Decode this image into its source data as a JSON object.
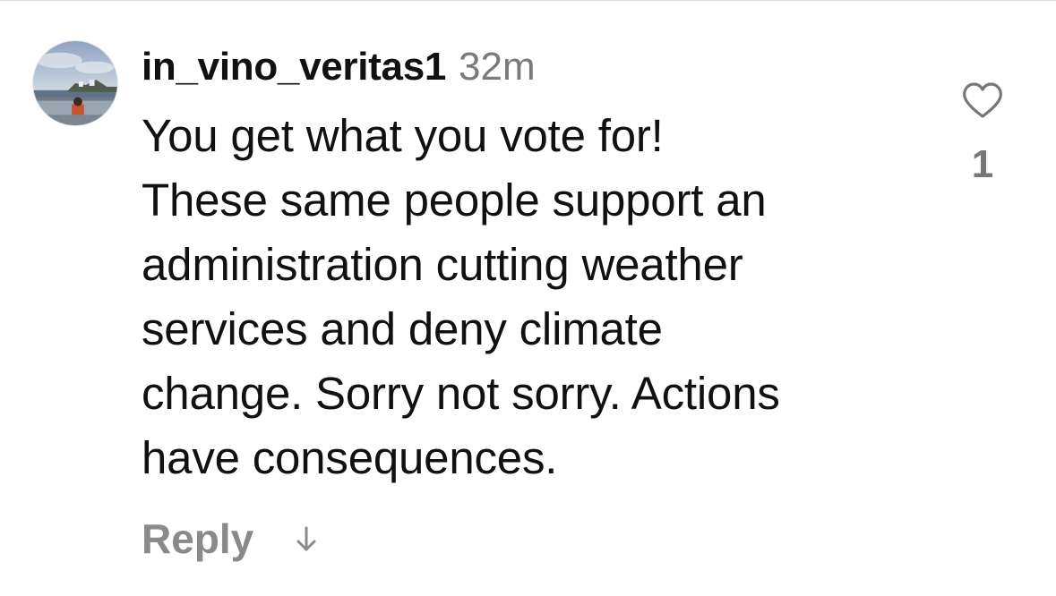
{
  "comment": {
    "username": "in_vino_veritas1",
    "timestamp": "32m",
    "text_lines": [
      "You get what you vote for!",
      "These same people support an",
      "administration cutting weather",
      "services and deny climate",
      "change. Sorry not sorry. Actions",
      "have consequences."
    ],
    "reply_label": "Reply",
    "reply_arrow_icon": "down-arrow-icon",
    "like_icon": "heart-outline-icon",
    "like_count": "1"
  },
  "colors": {
    "text": "#111111",
    "muted": "#7a7a7a",
    "reply": "#8a8a8a",
    "icon": "#777777"
  }
}
